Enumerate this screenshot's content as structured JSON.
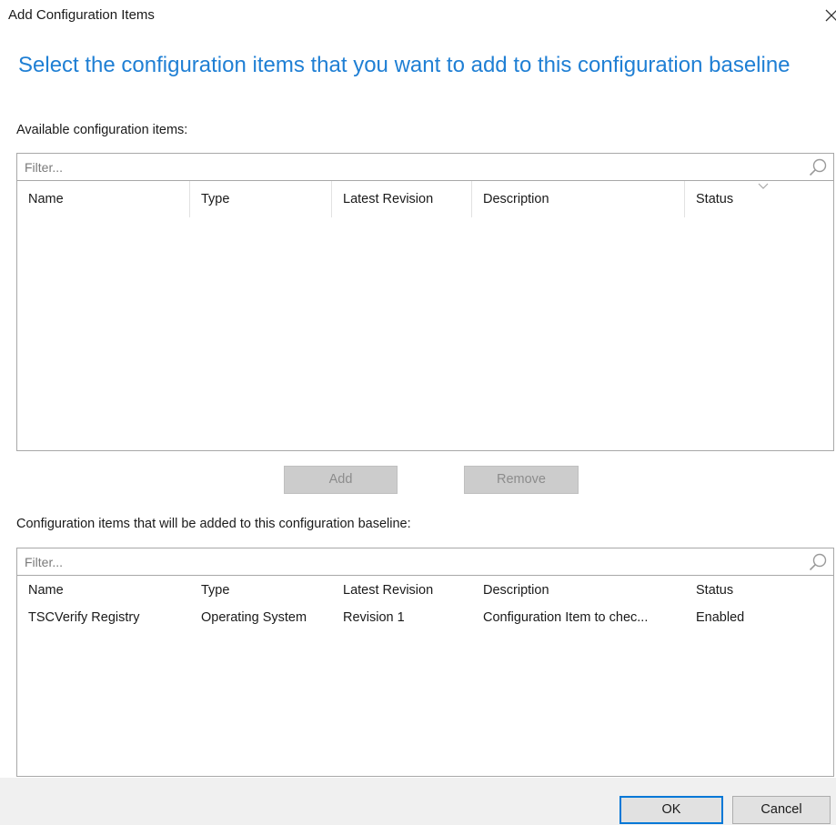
{
  "window": {
    "title": "Add Configuration Items",
    "close_glyph": "close-icon"
  },
  "heading": "Select the configuration items that you want to add to this configuration baseline",
  "available": {
    "label": "Available configuration items:",
    "filter_placeholder": "Filter...",
    "columns": [
      "Name",
      "Type",
      "Latest Revision",
      "Description",
      "Status"
    ],
    "rows": []
  },
  "actions": {
    "add_label": "Add",
    "remove_label": "Remove"
  },
  "selected": {
    "label": "Configuration items that will be added to this configuration baseline:",
    "filter_placeholder": "Filter...",
    "columns": [
      "Name",
      "Type",
      "Latest Revision",
      "Description",
      "Status"
    ],
    "rows": [
      [
        "TSCVerify Registry",
        "Operating System",
        "Revision 1",
        "Configuration Item to chec...",
        "Enabled"
      ]
    ]
  },
  "footer": {
    "ok_label": "OK",
    "cancel_label": "Cancel"
  },
  "colors": {
    "heading": "#1f7fd4",
    "default_button_border": "#0078d7",
    "disabled_button": "#cccccc"
  }
}
